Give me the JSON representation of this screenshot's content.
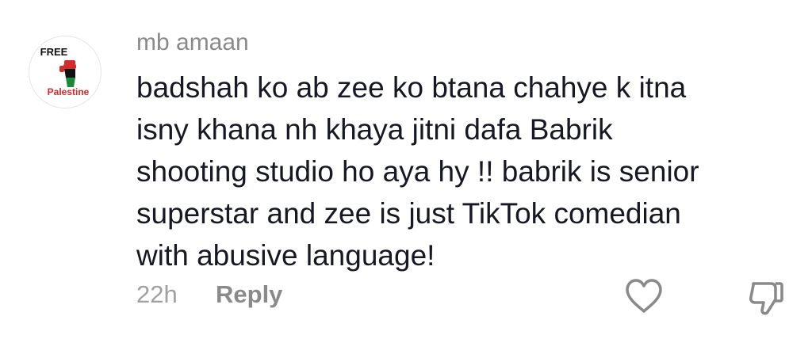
{
  "comment": {
    "avatar": {
      "text_top": "FREE",
      "text_bottom": "Palestine",
      "colors": {
        "black": "#111111",
        "green": "#1a8a3a",
        "red": "#d42a2a"
      }
    },
    "username": "mb amaan",
    "body_lines": [
      "badshah ko ab zee ko btana chahye k itna",
      "isny khana nh khaya jitni dafa Babrik",
      "shooting studio ho aya hy !! babrik is senior",
      "superstar and zee is just TikTok comedian",
      "with abusive language!"
    ],
    "timestamp": "22h",
    "reply_label": "Reply",
    "icons": {
      "like": "heart-icon",
      "dislike": "thumbs-down-icon"
    },
    "colors": {
      "text": "#161823",
      "username": "#8a8a8a",
      "meta": "#a0a0a0",
      "icon_stroke": "#8a8a8a"
    }
  }
}
